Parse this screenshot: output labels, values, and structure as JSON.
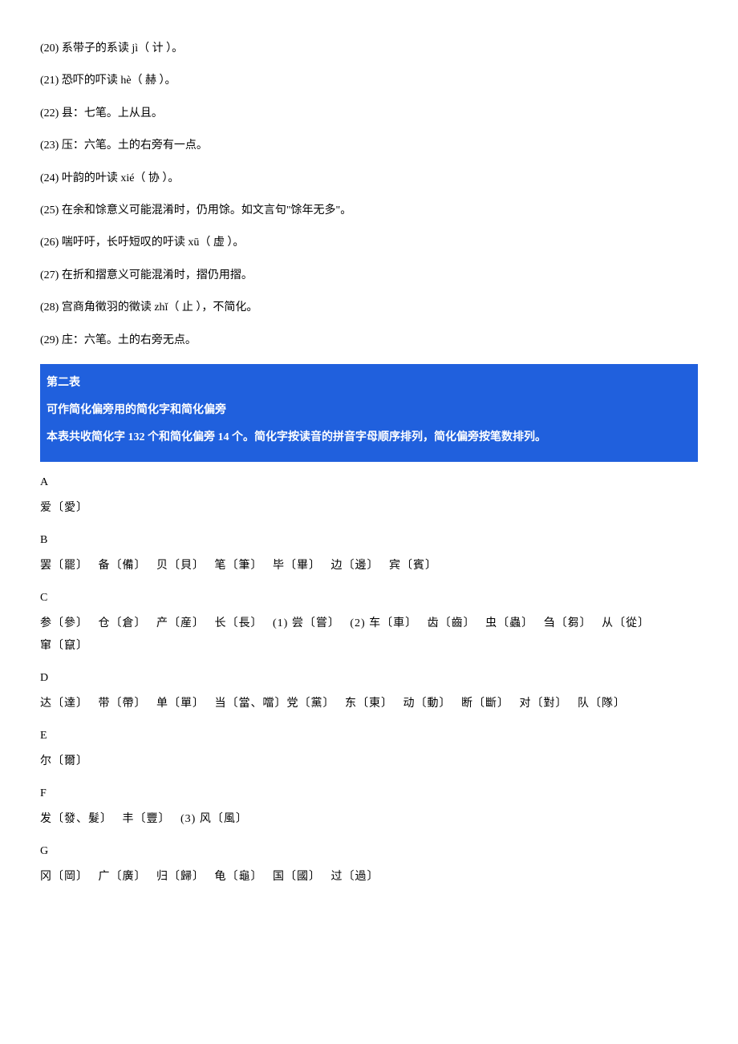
{
  "notes": [
    "(20) 系带子的系读 jì（ 计 ）。",
    "(21) 恐吓的吓读 hè（ 赫 ）。",
    "(22) 县：七笔。上从且。",
    "(23) 压：六笔。土的右旁有一点。",
    "(24) 叶韵的叶读 xié（ 协 ）。",
    "(25) 在余和馀意义可能混淆时，仍用馀。如文言句\"馀年无多\"。",
    "(26) 喘吁吁，长吁短叹的吁读 xū（ 虚 ）。",
    "(27) 在折和摺意义可能混淆时，摺仍用摺。",
    "(28) 宫商角徵羽的徵读 zhǐ（ 止 ），不简化。",
    "(29) 庄：六笔。土的右旁无点。"
  ],
  "section2": {
    "title": "第二表",
    "subtitle": "可作简化偏旁用的简化字和简化偏旁",
    "desc": "本表共收简化字 132 个和简化偏旁 14 个。简化字按读音的拼音字母顺序排列，简化偏旁按笔数排列。"
  },
  "groups": [
    {
      "letter": "A",
      "entries": [
        "爱〔愛〕"
      ]
    },
    {
      "letter": "B",
      "entries": [
        "罢〔罷〕",
        "备〔備〕",
        "贝〔貝〕",
        "笔〔筆〕",
        "毕〔畢〕",
        "边〔邊〕",
        "宾〔賓〕"
      ]
    },
    {
      "letter": "C",
      "entries": [
        "参〔參〕",
        "仓〔倉〕",
        "产〔産〕",
        "长〔長〕",
        "(1) 尝〔嘗〕",
        "(2) 车〔車〕",
        "齿〔齒〕",
        "虫〔蟲〕",
        "刍〔芻〕",
        "从〔從〕",
        "窜〔竄〕"
      ]
    },
    {
      "letter": "D",
      "entries": [
        "达〔達〕",
        "带〔帶〕",
        "单〔單〕",
        "当〔當、噹〕党〔黨〕",
        "东〔東〕",
        "动〔動〕",
        "断〔斷〕",
        "对〔對〕",
        "队〔隊〕"
      ]
    },
    {
      "letter": "E",
      "entries": [
        "尔〔爾〕"
      ]
    },
    {
      "letter": "F",
      "entries": [
        "发〔發、髮〕",
        "丰〔豐〕",
        "(3) 风〔風〕"
      ]
    },
    {
      "letter": "G",
      "entries": [
        "冈〔岡〕",
        "广〔廣〕",
        "归〔歸〕",
        "龟〔龜〕",
        "国〔國〕",
        "过〔過〕"
      ]
    }
  ]
}
